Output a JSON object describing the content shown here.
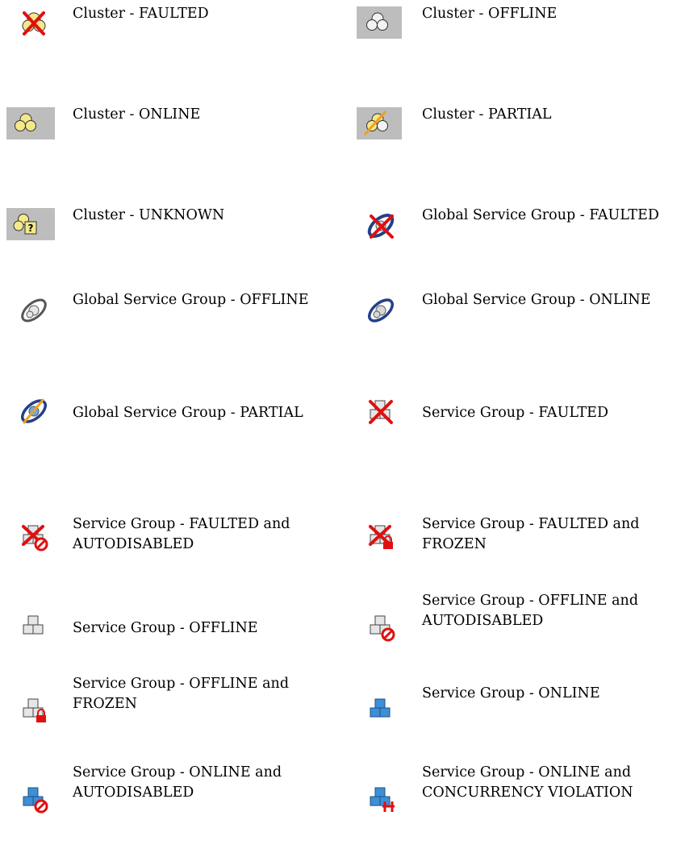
{
  "legend": {
    "entries": [
      {
        "label_line1": "Cluster - FAULTED",
        "label_line2": "",
        "icon": "cluster-faulted-icon"
      },
      {
        "label_line1": "Cluster - OFFLINE",
        "label_line2": "",
        "icon": "cluster-offline-icon"
      },
      {
        "label_line1": "Cluster - ONLINE",
        "label_line2": "",
        "icon": "cluster-online-icon"
      },
      {
        "label_line1": "Cluster - PARTIAL",
        "label_line2": "",
        "icon": "cluster-partial-icon"
      },
      {
        "label_line1": "Cluster - UNKNOWN",
        "label_line2": "",
        "icon": "cluster-unknown-icon"
      },
      {
        "label_line1": "Global Service Group - FAULTED",
        "label_line2": "",
        "icon": "global-service-group-faulted-icon"
      },
      {
        "label_line1": "Global Service Group - OFFLINE",
        "label_line2": "",
        "icon": "global-service-group-offline-icon"
      },
      {
        "label_line1": "Global Service Group - ONLINE",
        "label_line2": "",
        "icon": "global-service-group-online-icon"
      },
      {
        "label_line1": "Global Service Group - PARTIAL",
        "label_line2": "",
        "icon": "global-service-group-partial-icon"
      },
      {
        "label_line1": "Service Group - FAULTED",
        "label_line2": "",
        "icon": "service-group-faulted-icon"
      },
      {
        "label_line1": "Service Group - FAULTED and",
        "label_line2": "AUTODISABLED",
        "icon": "service-group-faulted-autodisabled-icon"
      },
      {
        "label_line1": "Service Group - FAULTED and",
        "label_line2": "FROZEN",
        "icon": "service-group-faulted-frozen-icon"
      },
      {
        "label_line1": "Service Group - OFFLINE",
        "label_line2": "",
        "icon": "service-group-offline-icon"
      },
      {
        "label_line1": "Service Group - OFFLINE and",
        "label_line2": "AUTODISABLED",
        "icon": "service-group-offline-autodisabled-icon"
      },
      {
        "label_line1": "Service Group - OFFLINE and",
        "label_line2": "FROZEN",
        "icon": "service-group-offline-frozen-icon"
      },
      {
        "label_line1": "Service Group - ONLINE",
        "label_line2": "",
        "icon": "service-group-online-icon"
      },
      {
        "label_line1": "Service Group - ONLINE and",
        "label_line2": "AUTODISABLED",
        "icon": "service-group-online-autodisabled-icon"
      },
      {
        "label_line1": "Service Group - ONLINE and",
        "label_line2": "CONCURRENCY VIOLATION",
        "icon": "service-group-online-concurrency-violation-icon"
      }
    ]
  },
  "colors": {
    "icon_bg": "#bdbdbd",
    "fault_red": "#e01010",
    "online_yellow": "#f5e88a",
    "offline_grey": "#e6e6e6",
    "online_blue": "#3d8fd6",
    "ring_blue": "#24408a"
  }
}
